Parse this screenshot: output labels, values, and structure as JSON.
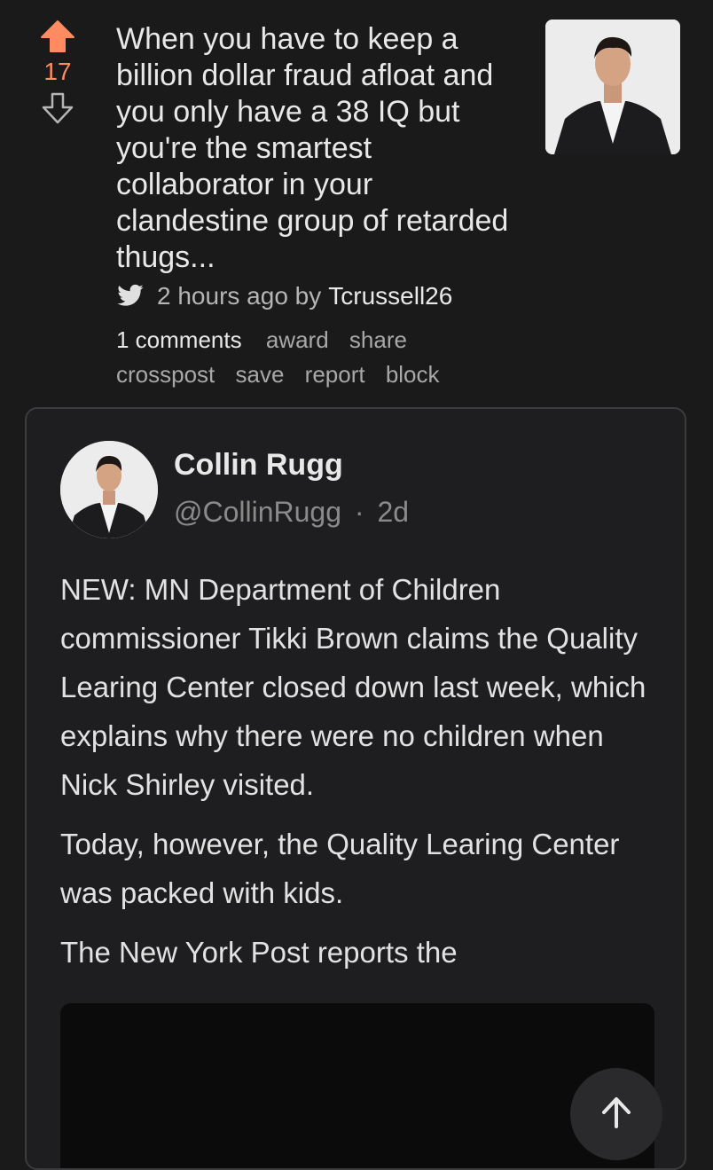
{
  "post": {
    "score": "17",
    "title": "When you have to keep a billion dollar fraud afloat and you only have a 38 IQ but you're the smartest collaborator in your clandestine group of retarded thugs...",
    "time_prefix": "2 hours ago by",
    "author": "Tcrussell26",
    "actions_row1": [
      "1 comments",
      "award",
      "share"
    ],
    "actions_row2": [
      "crosspost",
      "save",
      "report",
      "block"
    ],
    "upvote_color": "#ff8b60"
  },
  "embed": {
    "name": "Collin Rugg",
    "handle": "@CollinRugg",
    "separator": "·",
    "age": "2d",
    "paragraphs": [
      "NEW: MN Department of Children commissioner Tikki Brown claims the Quality Learing Center closed down last week, which explains why there were no children when Nick Shirley visited.",
      "Today, however, the Quality Learing Center was packed with kids.",
      "The New York Post reports the"
    ]
  },
  "icons": {
    "upvote": "arrow-up-icon",
    "downvote": "arrow-down-icon",
    "source": "twitter-bird-icon",
    "scroll_top": "arrow-up-icon"
  }
}
